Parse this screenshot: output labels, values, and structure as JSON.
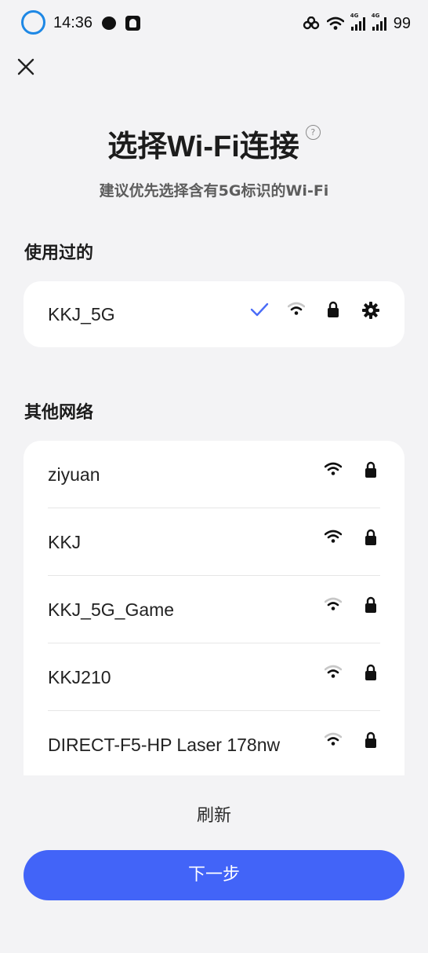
{
  "status_bar": {
    "time": "14:36",
    "battery": "99",
    "network_tag": "4G"
  },
  "title": "选择Wi-Fi连接",
  "help_glyph": "?",
  "subtitle": "建议优先选择含有5G标识的Wi-Fi",
  "used_section": {
    "label": "使用过的",
    "network": {
      "name": "KKJ_5G",
      "connected": true,
      "secured": true,
      "signal": "weak"
    }
  },
  "other_section": {
    "label": "其他网络",
    "networks": [
      {
        "name": "ziyuan",
        "signal": "strong",
        "secured": true
      },
      {
        "name": "KKJ",
        "signal": "strong",
        "secured": true
      },
      {
        "name": "KKJ_5G_Game",
        "signal": "weak",
        "secured": true
      },
      {
        "name": "KKJ210",
        "signal": "weak",
        "secured": true
      },
      {
        "name": "DIRECT-F5-HP Laser 178nw",
        "signal": "weak",
        "secured": true
      }
    ]
  },
  "refresh_label": "刷新",
  "next_label": "下一步",
  "colors": {
    "accent": "#4264f8",
    "check": "#4a6cf7",
    "ring": "#1e88e5",
    "background": "#f3f3f5"
  }
}
